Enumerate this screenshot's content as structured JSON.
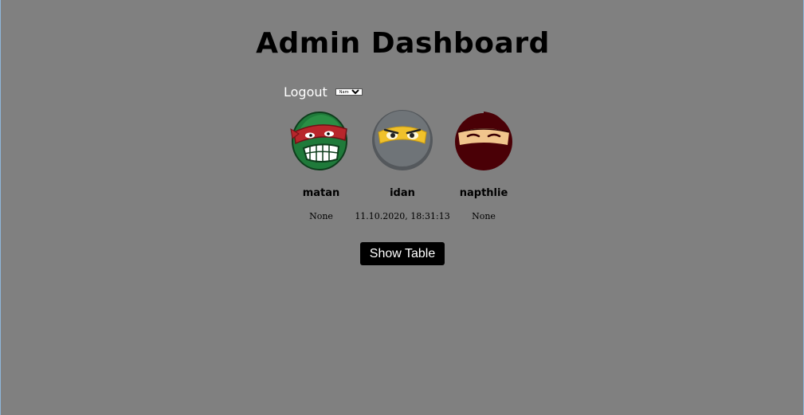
{
  "page": {
    "title": "Admin Dashboard",
    "background": "#808080"
  },
  "toolbar": {
    "logout_label": "Logout",
    "sort_select": {
      "selected": "Name",
      "options": [
        "Name"
      ]
    }
  },
  "users": [
    {
      "name": "matan",
      "last_login": "None",
      "avatar_icon": "ninja-turtle-red-mask-icon"
    },
    {
      "name": "idan",
      "last_login": "11.10.2020, 18:31:13",
      "avatar_icon": "ninja-gray-yellow-mask-icon"
    },
    {
      "name": "napthlie",
      "last_login": "None",
      "avatar_icon": "ninja-maroon-hood-icon"
    }
  ],
  "actions": {
    "show_table_label": "Show Table"
  }
}
